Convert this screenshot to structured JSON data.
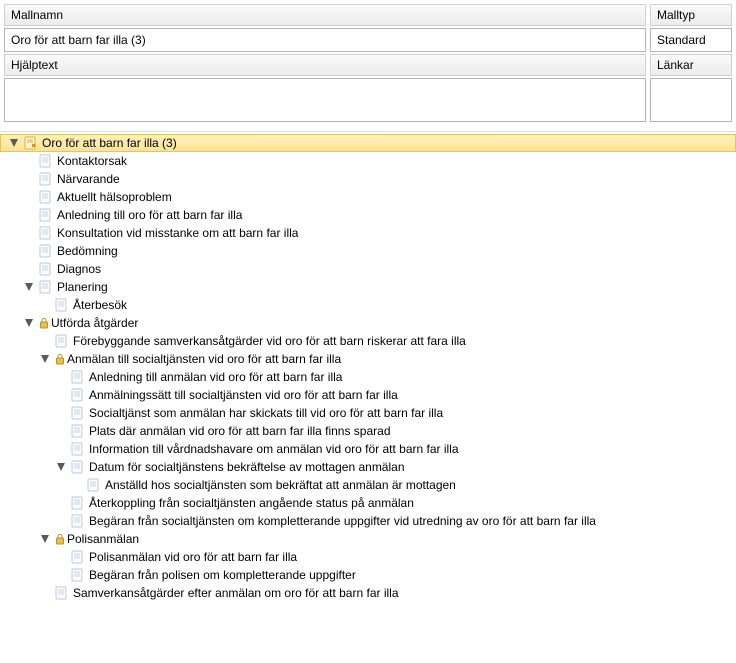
{
  "form": {
    "mallnamn_label": "Mallnamn",
    "mallnamn_value": "Oro för att barn far illa (3)",
    "malltyp_label": "Malltyp",
    "malltyp_value": "Standard",
    "hjalptext_label": "Hjälptext",
    "hjalptext_value": "",
    "lankar_label": "Länkar"
  },
  "tree": {
    "root_label": "Oro för att barn far illa (3)",
    "nodes": {
      "kontaktorsak": "Kontaktorsak",
      "narvarande": "Närvarande",
      "aktuellt_halsoproblem": "Aktuellt hälsoproblem",
      "anledning_oro": "Anledning till oro för att barn far illa",
      "konsultation": "Konsultation vid misstanke om att barn far illa",
      "bedomning": "Bedömning",
      "diagnos": "Diagnos",
      "planering": "Planering",
      "aterbesok": "Återbesök",
      "utforda_atgarder": "Utförda åtgärder",
      "forebyggande": "Förebyggande samverkansåtgärder vid oro för att barn riskerar att fara illa",
      "anmalan_social": "Anmälan till socialtjänsten vid oro för att barn far illa",
      "anledning_anmalan": "Anledning till anmälan vid oro för att barn far illa",
      "anmalningssatt": "Anmälningssätt till socialtjänsten vid oro för att barn far illa",
      "socialtjanst_skickat": "Socialtjänst som anmälan har skickats till vid oro för att barn far illa",
      "plats_sparad": "Plats där anmälan vid oro för att barn far illa finns sparad",
      "info_vardnadshavare": "Information till vårdnadshavare om anmälan vid oro för att barn far illa",
      "datum_bekraftelse": "Datum för socialtjänstens bekräftelse av mottagen anmälan",
      "anstalld_bekraftat": "Anställd hos socialtjänsten som bekräftat att anmälan är mottagen",
      "aterkoppling": "Återkoppling från socialtjänsten angående status på anmälan",
      "begaran_social": "Begäran från socialtjänsten om kompletterande uppgifter vid utredning av oro för att barn far illa",
      "polisanmalan": "Polisanmälan",
      "polisanmalan_oro": "Polisanmälan vid oro för att barn far illa",
      "begaran_polis": "Begäran från polisen om kompletterande uppgifter",
      "samverkan_efter": "Samverkansåtgärder efter anmälan om oro för att barn far illa"
    }
  }
}
